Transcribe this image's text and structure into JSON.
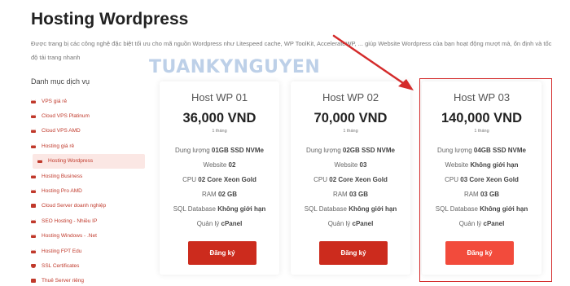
{
  "page": {
    "title": "Hosting Wordpress",
    "description": "Được trang bị các công nghệ đặc biệt tối ưu cho mã nguồn Wordpress như Litespeed cache, WP ToolKit, AccelerateWP, ... giúp Website Wordpress của bạn hoạt động mượt mà, ổn định và tốc độ tải trang nhanh",
    "watermark": "TUANKYNGUYEN"
  },
  "sidebar": {
    "title": "Danh mục dịch vụ",
    "items": [
      {
        "label": "VPS giá rẻ",
        "icon": "server-icon"
      },
      {
        "label": "Cloud VPS Platinum",
        "icon": "server-icon"
      },
      {
        "label": "Cloud VPS AMD",
        "icon": "server-icon"
      },
      {
        "label": "Hosting giá rẻ",
        "icon": "server-icon"
      },
      {
        "label": "Hosting Wordpress",
        "icon": "server-icon",
        "active": true
      },
      {
        "label": "Hosting Business",
        "icon": "server-icon"
      },
      {
        "label": "Hosting Pro AMD",
        "icon": "server-icon"
      },
      {
        "label": "Cloud Server doanh nghiệp",
        "icon": "lock-icon"
      },
      {
        "label": "SEO Hosting - Nhiều IP",
        "icon": "server-icon"
      },
      {
        "label": "Hosting Windows - .Net",
        "icon": "server-icon"
      },
      {
        "label": "Hosting FPT Edu",
        "icon": "server-icon"
      },
      {
        "label": "SSL Certificates",
        "icon": "shield-icon"
      },
      {
        "label": "Thuê Server riêng",
        "icon": "lock-icon"
      }
    ]
  },
  "plans": [
    {
      "name": "Host WP 01",
      "price": "36,000 VND",
      "period": "1 tháng",
      "specs": [
        {
          "label": "Dung lượng ",
          "value": "01GB SSD NVMe"
        },
        {
          "label": "Website ",
          "value": "02"
        },
        {
          "label": "CPU ",
          "value": "02 Core Xeon Gold"
        },
        {
          "label": "RAM ",
          "value": "02 GB"
        },
        {
          "label": "SQL Database ",
          "value": "Không giới hạn"
        },
        {
          "label": "Quản lý ",
          "value": "cPanel"
        }
      ],
      "button": "Đăng ký"
    },
    {
      "name": "Host WP 02",
      "price": "70,000 VND",
      "period": "1 tháng",
      "specs": [
        {
          "label": "Dung lượng ",
          "value": "02GB SSD NVMe"
        },
        {
          "label": "Website ",
          "value": "03"
        },
        {
          "label": "CPU ",
          "value": "02 Core Xeon Gold"
        },
        {
          "label": "RAM ",
          "value": "03 GB"
        },
        {
          "label": "SQL Database ",
          "value": "Không giới hạn"
        },
        {
          "label": "Quản lý ",
          "value": "cPanel"
        }
      ],
      "button": "Đăng ký"
    },
    {
      "name": "Host WP 03",
      "price": "140,000 VND",
      "period": "1 tháng",
      "specs": [
        {
          "label": "Dung lượng ",
          "value": "04GB SSD NVMe"
        },
        {
          "label": "Website ",
          "value": "Không giới hạn"
        },
        {
          "label": "CPU ",
          "value": "03 Core Xeon Gold"
        },
        {
          "label": "RAM ",
          "value": "03 GB"
        },
        {
          "label": "SQL Database ",
          "value": "Không giới hạn"
        },
        {
          "label": "Quản lý ",
          "value": "cPanel"
        }
      ],
      "button": "Đăng ký"
    }
  ],
  "colors": {
    "accent": "#cc2b1d",
    "highlight_button": "#f24b3c",
    "annotation": "#d42b2b"
  }
}
